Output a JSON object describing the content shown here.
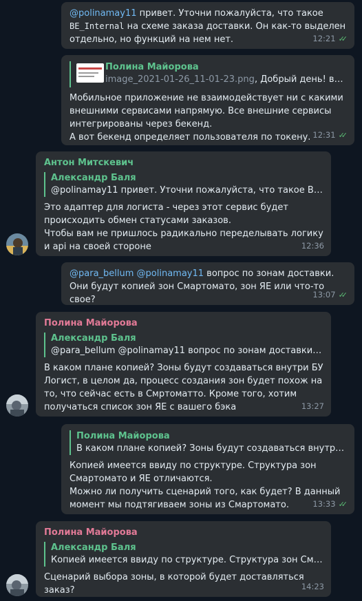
{
  "messages": {
    "m1": {
      "mention": "@polinamay11",
      "t1": " привет. Уточни пожалуйста, что такое ",
      "code": "BE_Internal",
      "t2": " на схеме заказа доставки. Он как-то выделен отдельно, но функций на нем нет.",
      "time": "12:21"
    },
    "m2": {
      "reply_name": "Полина Майорова",
      "reply_file": "image_2021-01-26_11-01-23.png",
      "reply_text": ", Добрый день! все же хо...",
      "text": "Мобильное приложение не взаимодействует ни с какими внешними сервисами напрямую. Все внешние сервисы интегрированы через бекенд.\nА вот бекенд определяет пользователя по токену.",
      "time": "12:31"
    },
    "m3": {
      "author": "Антон Митскевич",
      "reply_name": "Александр Баля",
      "reply_text": "@polinamay11 привет. Уточни пожалуйста, что такое BE_Inter...",
      "text": "Это адаптер для логиста - через этот сервис будет происходить обмен статусами заказов.\nЧтобы вам не пришлось радикально переделывать логику и api на своей стороне",
      "time": "12:36"
    },
    "m4": {
      "mention1": "@para_bellum",
      "mention2": "@polinamay11",
      "text": " вопрос по зонам доставки. Они будут копией зон Смартомато, зон ЯЕ или что-то свое?",
      "time": "13:07"
    },
    "m5": {
      "author": "Полина Майорова",
      "reply_name": "Александр Баля",
      "reply_text": "@para_bellum @polinamay11 вопрос по зонам доставки. Они ...",
      "text": "В каком плане копией? Зоны будут создаваться внутри БУ Логист, в целом да, процесс создания зон будет похож на то, что сейчас есть в Смртоматто. Кроме того, хотим получаться список зон ЯЕ с вашего бэка",
      "time": "13:27"
    },
    "m6": {
      "reply_name": "Полина Майорова",
      "reply_text": "В каком плане копией? Зоны будут создаваться внутри БУ Ло...",
      "text": "Копией имеется ввиду по структуре. Структура зон Смартомато и ЯЕ отличаются.\nМожно ли получить сценарий того, как будет? В данный момент мы подтягиваем зоны из Смартомато.",
      "time": "13:33"
    },
    "m7": {
      "author": "Полина Майорова",
      "reply_name": "Александр Баля",
      "reply_text": "Копией имеется ввиду по структуре. Структура зон Смартом...",
      "text": "Сценарий выбора зоны, в которой будет доставляться заказ?",
      "time": "14:23"
    }
  },
  "icons": {
    "read_checks": "double-check-icon",
    "check_glyph": "✓✓"
  },
  "colors": {
    "background": "#0e1621",
    "bubble": "#2b2f33",
    "mention": "#71baf4",
    "green_name": "#5ec38e",
    "pink_name": "#e27a97",
    "checks": "#5bbd74"
  }
}
